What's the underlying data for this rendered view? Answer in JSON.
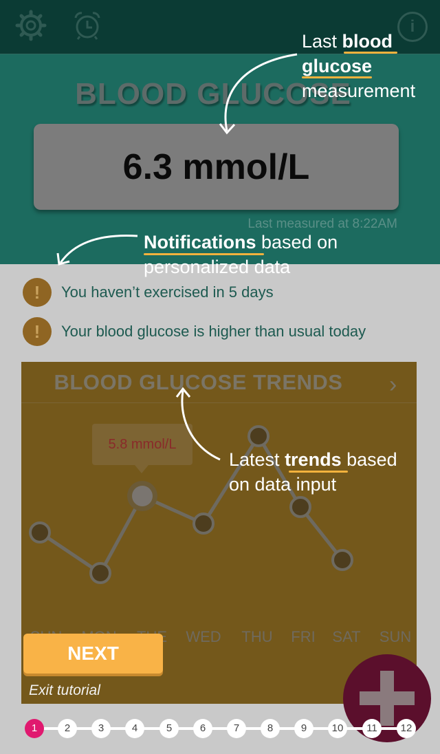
{
  "header": {
    "title": "BLOOD GLUCOSE",
    "reading": "6.3 mmol/L",
    "last_measured": "Last measured at 8:22AM"
  },
  "topbar": {
    "icons": [
      "gear-icon",
      "alarm-clock-icon",
      "info-icon"
    ],
    "info_glyph": "i"
  },
  "notifications": [
    {
      "icon": "!",
      "text": "You haven’t exercised in 5 days"
    },
    {
      "icon": "!",
      "text": "Your blood glucose is higher than usual today"
    }
  ],
  "trends": {
    "title": "BLOOD GLUCOSE TRENDS",
    "chevron": "›",
    "tooltip": "5.8 mmol/L",
    "days": [
      "SUN",
      "MON",
      "TUE",
      "WED",
      "THU",
      "FRI",
      "SAT",
      "SUN"
    ]
  },
  "tutorial": {
    "next_label": "NEXT",
    "exit_label": "Exit tutorial",
    "ann1": {
      "pre": "Last ",
      "bold1": "blood",
      "bold2": "glucose",
      "post": "measurement"
    },
    "ann2": {
      "bold": "Notifications",
      "post1": " based on",
      "line2": "personalized data"
    },
    "ann3": {
      "pre": "Latest ",
      "bold": "trends",
      "post1": " based",
      "line2": "on data input"
    },
    "steps": [
      "1",
      "2",
      "3",
      "4",
      "5",
      "6",
      "7",
      "8",
      "9",
      "10",
      "11",
      "12"
    ],
    "active_step": 1
  },
  "fab": {
    "icon": "plus-icon"
  },
  "colors": {
    "topbar": "#0b3b34",
    "header": "#1c6b5f",
    "accent": "#f9b347",
    "active_step": "#e0196f",
    "fab": "#5b0f2c"
  }
}
